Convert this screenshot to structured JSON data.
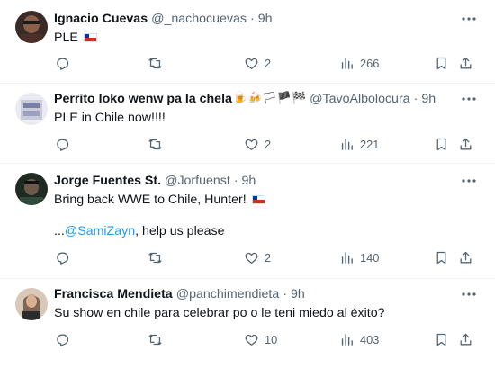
{
  "tweets": [
    {
      "name": "Ignacio Cuevas",
      "name_emoji": "",
      "handle": "@_nachocuevas",
      "time": "9h",
      "text": "PLE",
      "text_flag": true,
      "likes": "2",
      "views": "266",
      "avatar_color": "#6b4a3a"
    },
    {
      "name": "Perrito loko wenw pa la chela",
      "name_emoji": "🍺🍻🏳🏴🏁",
      "handle": "@TavoAlbolocura",
      "time": "9h",
      "text": "PLE in Chile now!!!!",
      "text_flag": false,
      "likes": "2",
      "views": "221",
      "avatar_color": "#cfd2e0"
    },
    {
      "name": "Jorge Fuentes St.",
      "name_emoji": "",
      "handle": "@Jorfuenst",
      "time": "9h",
      "text": "Bring back WWE to Chile, Hunter!",
      "text_flag": true,
      "mention_prefix": "...",
      "mention": "@SamiZayn",
      "mention_suffix": ", help us please",
      "likes": "2",
      "views": "140",
      "avatar_color": "#2d3a2a"
    },
    {
      "name": "Francisca Mendieta",
      "name_emoji": "",
      "handle": "@panchimendieta",
      "time": "9h",
      "text": "Su show en chile para celebrar po o le teni miedo al éxito?",
      "text_flag": false,
      "likes": "10",
      "views": "403",
      "avatar_color": "#b8927a"
    }
  ],
  "header_separator": "·",
  "colors": {
    "text": "#0f1419",
    "secondary": "#536471",
    "mention": "#1d9bf0",
    "border": "#eff3f4"
  },
  "icons": [
    "more-icon",
    "reply-icon",
    "retweet-icon",
    "like-icon",
    "views-icon",
    "bookmark-icon",
    "share-icon"
  ]
}
